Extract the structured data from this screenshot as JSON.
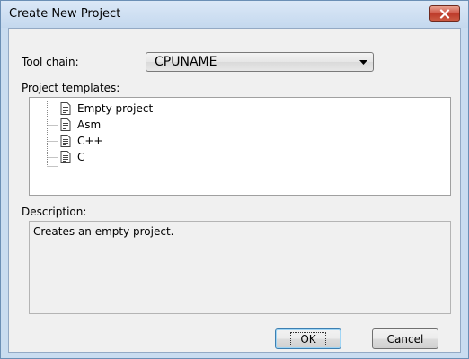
{
  "dialog": {
    "title": "Create New Project",
    "close_icon": "close-icon"
  },
  "toolchain": {
    "label": "Tool chain:",
    "selected": "CPUNAME"
  },
  "templates": {
    "label": "Project templates:",
    "items": [
      {
        "label": "Empty project",
        "icon": "document-icon"
      },
      {
        "label": "Asm",
        "icon": "document-icon"
      },
      {
        "label": "C++",
        "icon": "document-icon"
      },
      {
        "label": "C",
        "icon": "document-icon"
      }
    ]
  },
  "description": {
    "label": "Description:",
    "text": "Creates an empty project."
  },
  "buttons": {
    "ok": "OK",
    "cancel": "Cancel"
  },
  "colors": {
    "close_button": "#c9402f",
    "frame": "#c9dcf0",
    "dialog_bg": "#f0f0f0",
    "default_button_border": "#3c7fb1"
  }
}
